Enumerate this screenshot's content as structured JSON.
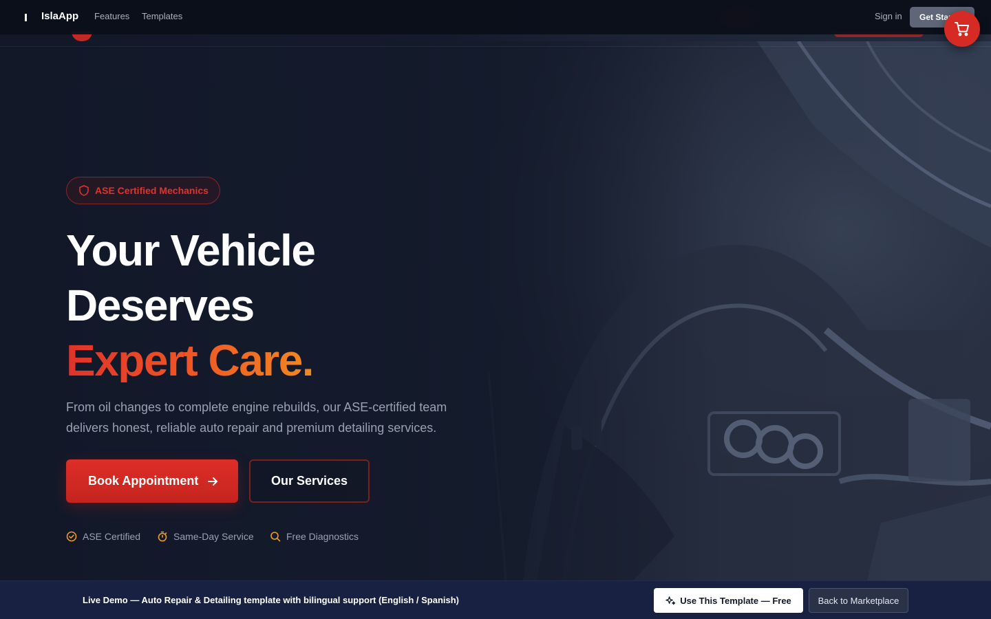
{
  "topbar": {
    "brand": "IslaApp",
    "nav": [
      "Features",
      "Templates"
    ],
    "signin": "Sign in",
    "get_started": "Get Started"
  },
  "hero": {
    "badge": "ASE Certified Mechanics",
    "title_line1": "Your Vehicle",
    "title_line2": "Deserves",
    "title_accent": "Expert Care.",
    "lead_line1": "From oil changes to complete engine rebuilds, our ASE-certified team",
    "lead_line2": "delivers honest, reliable auto repair and premium detailing services.",
    "primary_cta": "Book Appointment",
    "secondary_cta": "Our Services",
    "features": [
      {
        "label": "ASE Certified",
        "icon": "check-circle-icon"
      },
      {
        "label": "Same-Day Service",
        "icon": "stopwatch-icon"
      },
      {
        "label": "Free Diagnostics",
        "icon": "search-icon"
      }
    ]
  },
  "banner": {
    "text": "Live Demo — Auto Repair & Detailing template with bilingual support (English / Spanish)",
    "use_template": "Use This Template — Free",
    "back": "Back to Marketplace"
  },
  "colors": {
    "accent_red": "#d62b24",
    "accent_orange": "#f28a1e",
    "background": "#121828",
    "banner": "#192142"
  }
}
